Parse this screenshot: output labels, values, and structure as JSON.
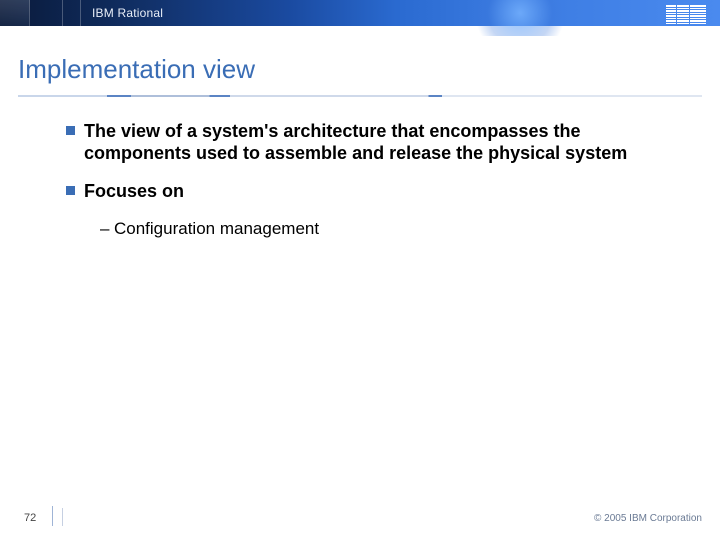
{
  "header": {
    "brand": "IBM Rational"
  },
  "title": "Implementation view",
  "bullets": [
    {
      "text": "The view of a system's architecture that encompasses the components used to assemble and release the physical system",
      "sub": []
    },
    {
      "text": "Focuses on",
      "sub": [
        "Configuration management"
      ]
    }
  ],
  "footer": {
    "page": "72",
    "copyright": "© 2005 IBM Corporation"
  }
}
